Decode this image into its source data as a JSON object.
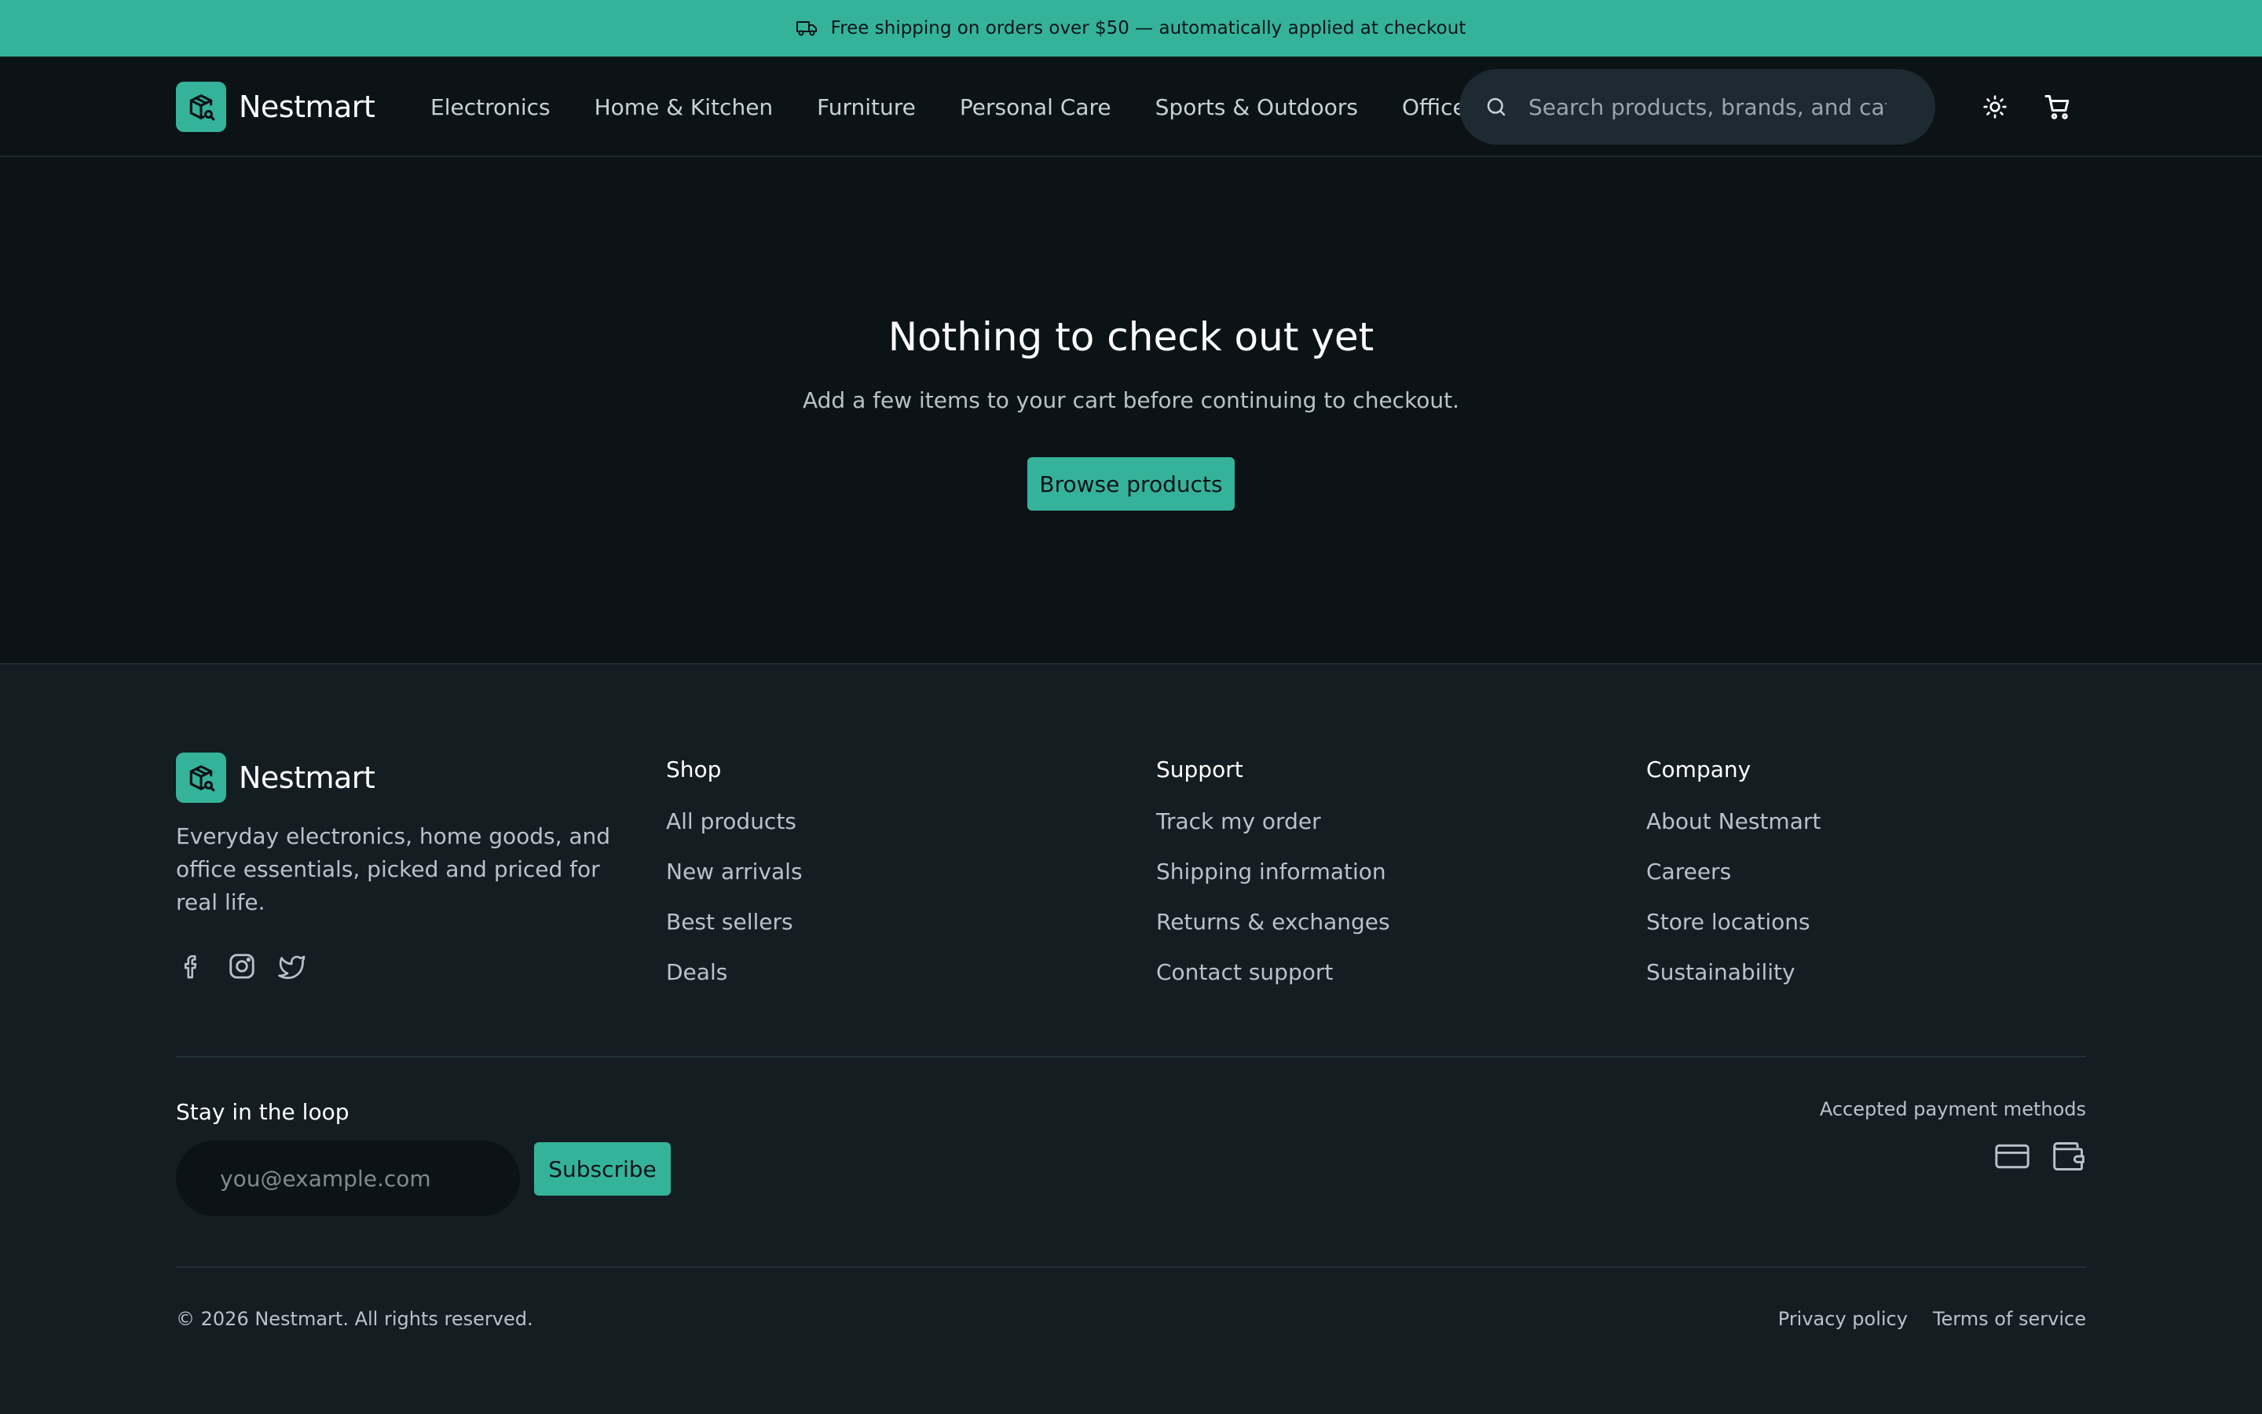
{
  "announcement": {
    "icon": "truck-icon",
    "text": "Free shipping on orders over $50 — automatically applied at checkout"
  },
  "header": {
    "brand": "Nestmart",
    "nav": [
      "Electronics",
      "Home & Kitchen",
      "Furniture",
      "Personal Care",
      "Sports & Outdoors",
      "Office"
    ],
    "search_placeholder": "Search products, brands, and categories",
    "icons": [
      "sun-icon",
      "cart-icon"
    ]
  },
  "empty_state": {
    "title": "Nothing to check out yet",
    "subtitle": "Add a few items to your cart before continuing to checkout.",
    "button": "Browse products"
  },
  "footer": {
    "brand": "Nestmart",
    "description": "Everyday electronics, home goods, and office essentials, picked and priced for real life.",
    "social_icons": [
      "facebook-icon",
      "instagram-icon",
      "twitter-icon"
    ],
    "columns": [
      {
        "title": "Shop",
        "links": [
          "All products",
          "New arrivals",
          "Best sellers",
          "Deals"
        ]
      },
      {
        "title": "Support",
        "links": [
          "Track my order",
          "Shipping information",
          "Returns & exchanges",
          "Contact support"
        ]
      },
      {
        "title": "Company",
        "links": [
          "About Nestmart",
          "Careers",
          "Store locations",
          "Sustainability"
        ]
      }
    ],
    "newsletter": {
      "title": "Stay in the loop",
      "placeholder": "you@example.com",
      "button": "Subscribe"
    },
    "payment": {
      "label": "Accepted payment methods",
      "icons": [
        "credit-card-icon",
        "wallet-icon"
      ]
    },
    "copyright": "© 2026 Nestmart. All rights reserved.",
    "legal": [
      "Privacy policy",
      "Terms of service"
    ]
  },
  "colors": {
    "accent": "#35b39a",
    "background": "#0c1317",
    "footer_background": "#131d22"
  }
}
